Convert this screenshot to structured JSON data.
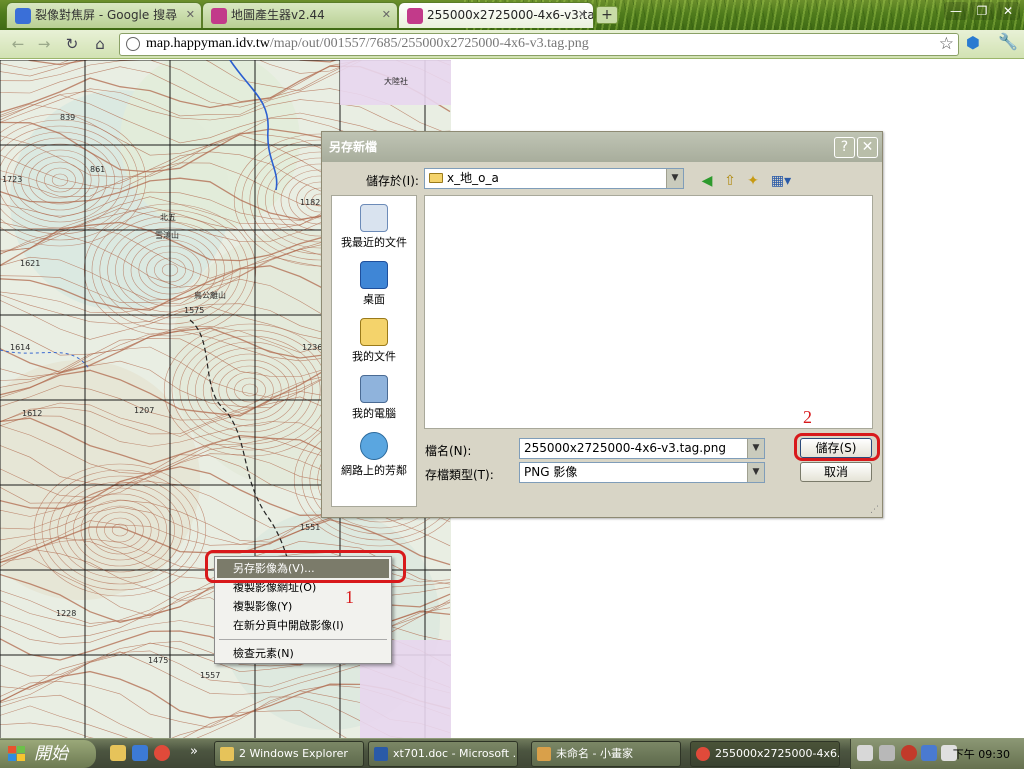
{
  "browser": {
    "tabs": [
      {
        "title": "裂像對焦屏 - Google 搜尋",
        "favicon_color": "#3a6fd8"
      },
      {
        "title": "地圖產生器v2.44",
        "favicon_color": "#c23a8a"
      },
      {
        "title": "255000x2725000-4x6-v3.tag.j",
        "favicon_color": "#c23a8a"
      }
    ],
    "new_tab_label": "+",
    "window_buttons": [
      "—",
      "❐",
      "✕"
    ],
    "url_host": "map.happyman.idv.tw",
    "url_path": "/map/out/001557/7685/255000x2725000-4x6-v3.tag.png"
  },
  "map": {
    "labels": [
      "大陸社",
      "839",
      "861",
      "1182",
      "1621",
      "1723",
      "1614",
      "1575",
      "1236",
      "1612",
      "1207",
      "1228",
      "1475",
      "1557",
      "1551",
      "北五",
      "雪鴻山",
      "鳥公離山"
    ]
  },
  "context_menu": {
    "items": [
      {
        "label": "另存影像為(V)...",
        "selected": true
      },
      {
        "label": "複製影像網址(O)",
        "selected": false
      },
      {
        "label": "複製影像(Y)",
        "selected": false
      },
      {
        "label": "在新分頁中開啟影像(I)",
        "selected": false
      },
      {
        "label": "檢查元素(N)",
        "selected": false
      }
    ],
    "annotation_number": "1"
  },
  "save_dialog": {
    "title": "另存新檔",
    "help_label": "?",
    "close_label": "✕",
    "save_in_label": "儲存於(I):",
    "save_in_value": "x_地_o_a",
    "places": [
      "我最近的文件",
      "桌面",
      "我的文件",
      "我的電腦",
      "網路上的芳鄰"
    ],
    "filename_label": "檔名(N):",
    "filename_value": "255000x2725000-4x6-v3.tag.png",
    "filetype_label": "存檔類型(T):",
    "filetype_value": "PNG 影像",
    "save_button": "儲存(S)",
    "cancel_button": "取消",
    "annotation_number": "2"
  },
  "taskbar": {
    "start_label": "開始",
    "chevron": "»",
    "items": [
      {
        "label": "2 Windows Explorer",
        "has_menu": true
      },
      {
        "label": "xt701.doc - Microsoft ...",
        "has_menu": false
      },
      {
        "label": "未命名 - 小畫家",
        "has_menu": false
      },
      {
        "label": "255000x2725000-4x6...",
        "has_menu": false,
        "active": true
      }
    ],
    "clock": "下午 09:30"
  },
  "colors": {
    "tab_bar": "#4f7b1c",
    "map_grid": "#1a1a1a",
    "contour": "#b06a4e",
    "highlight_red": "#d8191b"
  }
}
